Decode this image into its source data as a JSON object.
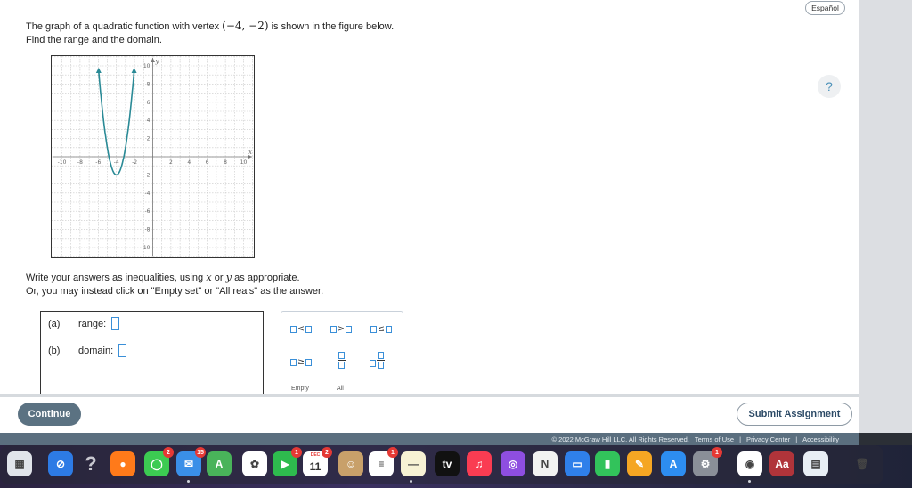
{
  "header": {
    "language_button": "Español",
    "help": "?"
  },
  "question": {
    "line1_before": "The graph of a quadratic function with vertex",
    "vertex": "(−4, −2)",
    "line1_after": "is shown in the figure below.",
    "line2": "Find the range and the domain."
  },
  "graph": {
    "x_ticks": [
      "-10",
      "-8",
      "-6",
      "-4",
      "-2",
      "2",
      "4",
      "6",
      "8",
      "10"
    ],
    "y_ticks": [
      "10",
      "8",
      "6",
      "4",
      "2",
      "-2",
      "-4",
      "-6",
      "-8",
      "-10"
    ],
    "x_axis_label": "x",
    "y_axis_label": "y",
    "curve_color": "#2a8a96",
    "vertex": [
      -4,
      -2
    ]
  },
  "instructions": {
    "line1_a": "Write your answers as inequalities, using",
    "var_x": "x",
    "or": "or",
    "var_y": "y",
    "line1_b": "as appropriate.",
    "line2": "Or, you may instead click on \"Empty set\" or \"All reals\" as the answer."
  },
  "answers": {
    "a_label": "(a)",
    "a_name": "range:",
    "b_label": "(b)",
    "b_name": "domain:"
  },
  "keypad": {
    "lt": "<",
    "gt": ">",
    "le": "≤",
    "ge": "≥",
    "empty": "Empty",
    "all": "All"
  },
  "buttons": {
    "continue": "Continue",
    "submit": "Submit Assignment"
  },
  "footer": {
    "copyright": "© 2022 McGraw Hill LLC. All Rights Reserved.",
    "terms": "Terms of Use",
    "sep1": "|",
    "privacy": "Privacy Center",
    "sep2": "|",
    "accessibility": "Accessibility"
  },
  "dock": {
    "icons": [
      {
        "name": "launchpad",
        "color": "#e0e4ea",
        "glyph": "▦"
      },
      {
        "name": "safari",
        "color": "#2d7be5",
        "glyph": "⊘"
      },
      {
        "name": "help",
        "color": "transparent",
        "glyph": "?"
      },
      {
        "name": "firefox",
        "color": "#ff7a1a",
        "glyph": "●"
      },
      {
        "name": "messages",
        "color": "#3ccb52",
        "glyph": "◯",
        "badge": "2"
      },
      {
        "name": "mail",
        "color": "#3a8fe8",
        "glyph": "✉",
        "badge": "15"
      },
      {
        "name": "maps",
        "color": "#49b35a",
        "glyph": "A"
      },
      {
        "name": "photos",
        "color": "#ffffff",
        "glyph": "✿"
      },
      {
        "name": "facetime",
        "color": "#2ebb4e",
        "glyph": "▶",
        "badge": "1"
      },
      {
        "name": "calendar",
        "color": "#ffffff",
        "glyph": "11",
        "badge": "2"
      },
      {
        "name": "contacts",
        "color": "#c8a06a",
        "glyph": "☺"
      },
      {
        "name": "reminders",
        "color": "#ffffff",
        "glyph": "≡",
        "badge": "1"
      },
      {
        "name": "notes",
        "color": "#f7f2d4",
        "glyph": "—"
      },
      {
        "name": "tv",
        "color": "#111111",
        "glyph": "tv"
      },
      {
        "name": "music",
        "color": "#fa3c52",
        "glyph": "♫"
      },
      {
        "name": "podcasts",
        "color": "#8e4ee0",
        "glyph": "◎"
      },
      {
        "name": "news",
        "color": "#f2f2f2",
        "glyph": "N"
      },
      {
        "name": "keynote",
        "color": "#2f80ea",
        "glyph": "▭"
      },
      {
        "name": "numbers",
        "color": "#32c35b",
        "glyph": "▮"
      },
      {
        "name": "pages",
        "color": "#f5a623",
        "glyph": "✎"
      },
      {
        "name": "app-store",
        "color": "#2d8df0",
        "glyph": "A"
      },
      {
        "name": "system-preferences",
        "color": "#8a8f98",
        "glyph": "⚙",
        "badge": "1"
      },
      {
        "name": "chrome",
        "color": "#ffffff",
        "glyph": "◉"
      },
      {
        "name": "dictionary",
        "color": "#b0343a",
        "glyph": "Aa"
      },
      {
        "name": "preview",
        "color": "#e8eef5",
        "glyph": "▤"
      },
      {
        "name": "trash",
        "color": "transparent",
        "glyph": "🗑"
      }
    ],
    "calendar_month": "DEC",
    "tv_label": "tv"
  }
}
